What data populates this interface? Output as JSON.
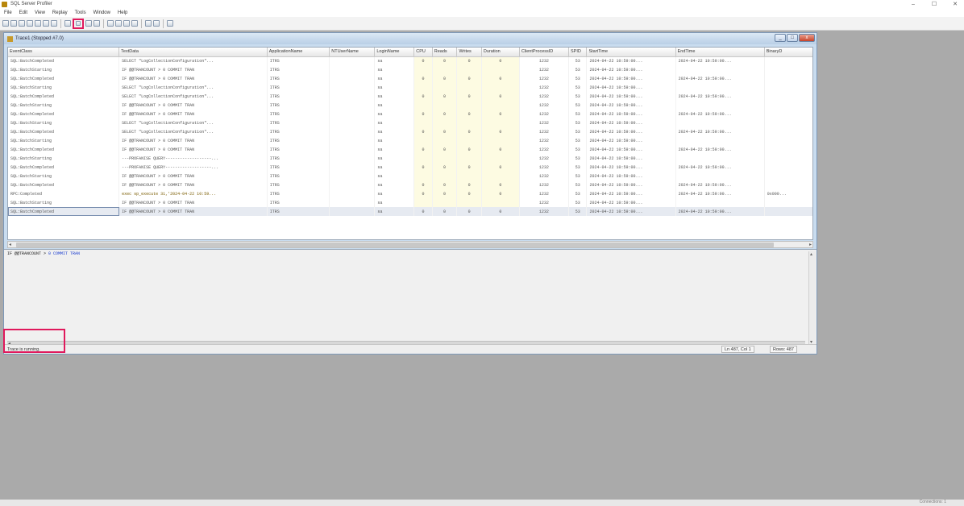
{
  "app": {
    "title": "SQL Server Profiler"
  },
  "window_controls": {
    "minimize": "–",
    "maximize": "☐",
    "close": "✕"
  },
  "menu": [
    "File",
    "Edit",
    "View",
    "Replay",
    "Tools",
    "Window",
    "Help"
  ],
  "child_window": {
    "title": "Trace1 (Stopped #7.0)",
    "min": "_",
    "max": "□",
    "close": "x"
  },
  "grid": {
    "columns": [
      "EventClass",
      "TextData",
      "ApplicationName",
      "NTUserName",
      "LoginName",
      "CPU",
      "Reads",
      "Writes",
      "Duration",
      "ClientProcessID",
      "SPID",
      "StartTime",
      "EndTime",
      "BinaryD"
    ],
    "rows": [
      [
        "SQL:BatchCompleted",
        "SELECT \"LogCollectionConfiguration\"...",
        "ITRS",
        "",
        "sa",
        "0",
        "0",
        "0",
        "0",
        "1232",
        "53",
        "2024-04-22 10:59:00...",
        "2024-04-22 10:59:00...",
        ""
      ],
      [
        "SQL:BatchStarting",
        "IF @@TRANCOUNT > 0 COMMIT TRAN",
        "ITRS",
        "",
        "sa",
        "",
        "",
        "",
        "",
        "1232",
        "53",
        "2024-04-22 10:59:00...",
        "",
        ""
      ],
      [
        "SQL:BatchCompleted",
        "IF @@TRANCOUNT > 0 COMMIT TRAN",
        "ITRS",
        "",
        "sa",
        "0",
        "0",
        "0",
        "0",
        "1232",
        "53",
        "2024-04-22 10:59:00...",
        "2024-04-22 10:59:00...",
        ""
      ],
      [
        "SQL:BatchStarting",
        "SELECT \"LogCollectionConfiguration\"...",
        "ITRS",
        "",
        "sa",
        "",
        "",
        "",
        "",
        "1232",
        "53",
        "2024-04-22 10:59:00...",
        "",
        ""
      ],
      [
        "SQL:BatchCompleted",
        "SELECT \"LogCollectionConfiguration\"...",
        "ITRS",
        "",
        "sa",
        "0",
        "0",
        "0",
        "0",
        "1232",
        "53",
        "2024-04-22 10:59:00...",
        "2024-04-22 10:59:00...",
        ""
      ],
      [
        "SQL:BatchStarting",
        "IF @@TRANCOUNT > 0 COMMIT TRAN",
        "ITRS",
        "",
        "sa",
        "",
        "",
        "",
        "",
        "1232",
        "53",
        "2024-04-22 10:59:00...",
        "",
        ""
      ],
      [
        "SQL:BatchCompleted",
        "IF @@TRANCOUNT > 0 COMMIT TRAN",
        "ITRS",
        "",
        "sa",
        "0",
        "0",
        "0",
        "0",
        "1232",
        "53",
        "2024-04-22 10:59:00...",
        "2024-04-22 10:59:00...",
        ""
      ],
      [
        "SQL:BatchStarting",
        "SELECT \"LogCollectionConfiguration\"...",
        "ITRS",
        "",
        "sa",
        "",
        "",
        "",
        "",
        "1232",
        "53",
        "2024-04-22 10:59:00...",
        "",
        ""
      ],
      [
        "SQL:BatchCompleted",
        "SELECT \"LogCollectionConfiguration\"...",
        "ITRS",
        "",
        "sa",
        "0",
        "0",
        "0",
        "0",
        "1232",
        "53",
        "2024-04-22 10:59:00...",
        "2024-04-22 10:59:00...",
        ""
      ],
      [
        "SQL:BatchStarting",
        "IF @@TRANCOUNT > 0 COMMIT TRAN",
        "ITRS",
        "",
        "sa",
        "",
        "",
        "",
        "",
        "1232",
        "53",
        "2024-04-22 10:59:00...",
        "",
        ""
      ],
      [
        "SQL:BatchCompleted",
        "IF @@TRANCOUNT > 0 COMMIT TRAN",
        "ITRS",
        "",
        "sa",
        "0",
        "0",
        "0",
        "0",
        "1232",
        "53",
        "2024-04-22 10:59:00...",
        "2024-04-22 10:59:00...",
        ""
      ],
      [
        "SQL:BatchStarting",
        "---PROFANISE QUERY-------------------...",
        "ITRS",
        "",
        "sa",
        "",
        "",
        "",
        "",
        "1232",
        "53",
        "2024-04-22 10:59:00...",
        "",
        ""
      ],
      [
        "SQL:BatchCompleted",
        "---PROFANISE QUERY-------------------...",
        "ITRS",
        "",
        "sa",
        "0",
        "0",
        "0",
        "0",
        "1232",
        "53",
        "2024-04-22 10:59:00...",
        "2024-04-22 10:59:00...",
        ""
      ],
      [
        "SQL:BatchStarting",
        "IF @@TRANCOUNT > 0 COMMIT TRAN",
        "ITRS",
        "",
        "sa",
        "",
        "",
        "",
        "",
        "1232",
        "53",
        "2024-04-22 10:59:00...",
        "",
        ""
      ],
      [
        "SQL:BatchCompleted",
        "IF @@TRANCOUNT > 0 COMMIT TRAN",
        "ITRS",
        "",
        "sa",
        "0",
        "0",
        "0",
        "0",
        "1232",
        "53",
        "2024-04-22 10:59:00...",
        "2024-04-22 10:59:00...",
        ""
      ],
      [
        "RPC:Completed",
        "exec sp_execute 31,'2024-04-22 10:59...",
        "ITRS",
        "",
        "sa",
        "0",
        "0",
        "0",
        "0",
        "1232",
        "53",
        "2024-04-22 10:59:00...",
        "2024-04-22 10:59:00...",
        "0x000..."
      ],
      [
        "SQL:BatchStarting",
        "IF @@TRANCOUNT > 0 COMMIT TRAN",
        "ITRS",
        "",
        "sa",
        "",
        "",
        "",
        "",
        "1232",
        "53",
        "2024-04-22 10:59:00...",
        "",
        ""
      ],
      [
        "SQL:BatchCompleted",
        "IF @@TRANCOUNT > 0 COMMIT TRAN",
        "ITRS",
        "",
        "sa",
        "0",
        "0",
        "0",
        "0",
        "1232",
        "53",
        "2024-04-22 10:59:00...",
        "2024-04-22 10:59:00...",
        ""
      ]
    ],
    "selected_row": 17
  },
  "textpane": {
    "text_plain": "IF @@TRANCOUNT > ",
    "text_kw": "0 COMMIT TRAN"
  },
  "status": {
    "message": "Trace is running.",
    "position": "Ln 487, Col 1",
    "rows": "Rows: 487"
  },
  "footer": {
    "label": "Connections: 1"
  },
  "colors": {
    "highlight": "#e0195c",
    "window_frame": "#c9dcef",
    "desktop": "#aaaaaa"
  }
}
